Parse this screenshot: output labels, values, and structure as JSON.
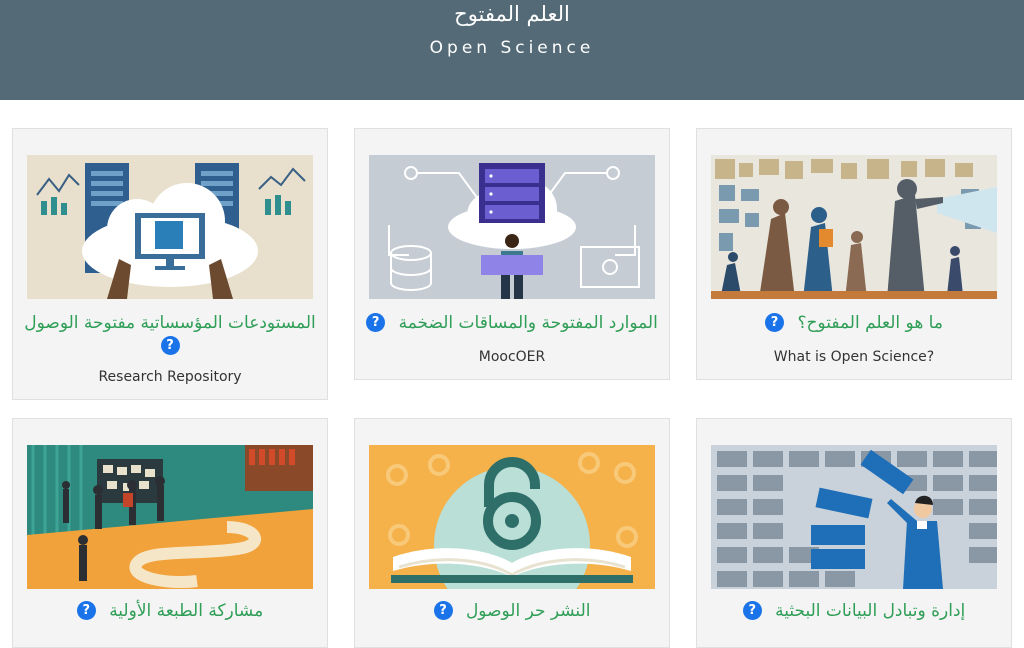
{
  "header": {
    "title_ar": "العلم المفتوح",
    "title_en": "Open Science"
  },
  "cards": [
    {
      "title_ar": "المستودعات المؤسساتية مفتوحة الوصول",
      "subtitle": "Research Repository",
      "help_icon": "?"
    },
    {
      "title_ar": "الموارد المفتوحة والمساقات الضخمة",
      "subtitle": "MoocOER",
      "help_icon": "?"
    },
    {
      "title_ar": "ما هو العلم المفتوح؟",
      "subtitle": "What is Open Science?",
      "help_icon": "?"
    },
    {
      "title_ar": "مشاركة الطبعة الأولية",
      "help_icon": "?"
    },
    {
      "title_ar": "النشر حر الوصول",
      "help_icon": "?"
    },
    {
      "title_ar": "إدارة وتبادل البيانات البحثية",
      "help_icon": "?"
    }
  ],
  "colors": {
    "header_bg": "#546a77",
    "title_green": "#2f9e57",
    "help_blue": "#1a73e8",
    "card_bg": "#f4f4f4"
  }
}
